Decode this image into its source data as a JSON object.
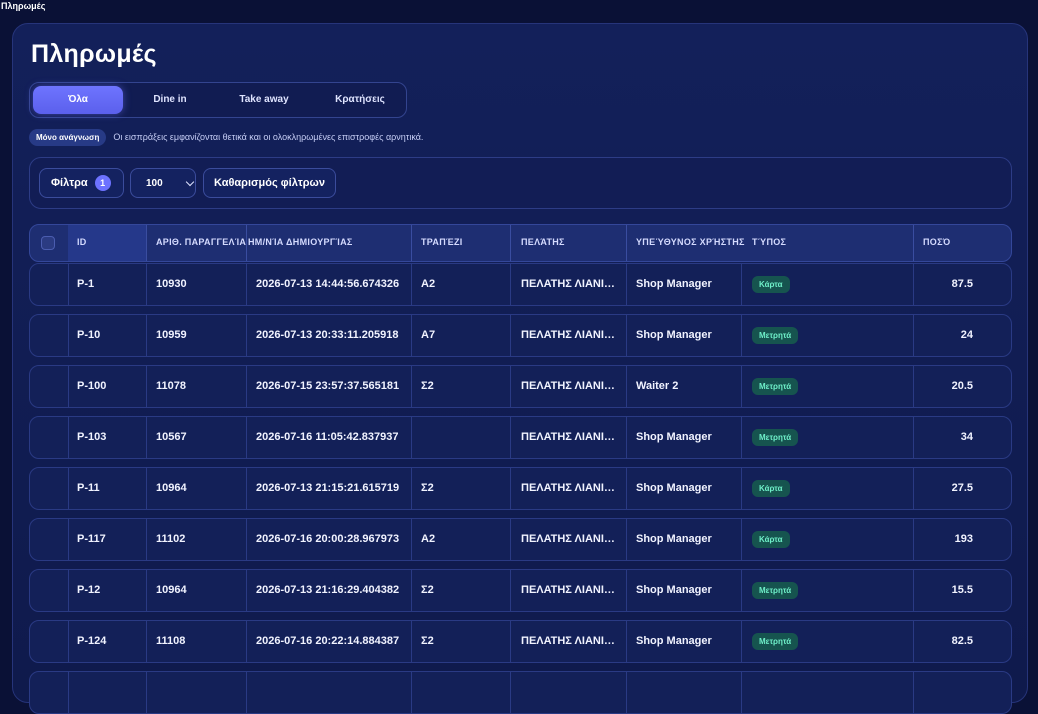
{
  "window": {
    "title": "Πληρωμές"
  },
  "page": {
    "title": "Πληρωμές"
  },
  "tabs": [
    {
      "label": "Όλα",
      "active": true
    },
    {
      "label": "Dine in",
      "active": false
    },
    {
      "label": "Take away",
      "active": false
    },
    {
      "label": "Κρατήσεις",
      "active": false
    }
  ],
  "readonly": {
    "badge": "Μόνο ανάγνωση",
    "note": "Οι εισπράξεις εμφανίζονται θετικά και οι ολοκληρωμένες επιστροφές αρνητικά."
  },
  "filters": {
    "filters_label": "Φίλτρα",
    "filters_count": "1",
    "page_size": "100",
    "clear_label": "Καθαρισμός φίλτρων"
  },
  "colors": {
    "accent": "#6d72ff",
    "background": "#0a1136",
    "payment_pill_bg": "#16544f",
    "payment_pill_text": "#6ff0c9"
  },
  "table": {
    "columns": {
      "id": "ID",
      "order_no": "ΑΡΙΘ. ΠΑΡΑΓΓΕΛΊΑΣ",
      "created": "ΗΜ/ΝΊΑ ΔΗΜΙΟΥΡΓΊΑΣ",
      "table": "ΤΡΑΠΈΖΙ",
      "customer": "ΠΕΛΆΤΗΣ",
      "user": "ΥΠΕΎΘΥΝΟΣ ΧΡΉΣΤΗΣ",
      "type": "ΤΎΠΟΣ",
      "amount": "ΠΟΣΌ"
    },
    "rows": [
      {
        "id": "P-1",
        "order_no": "10930",
        "created": "2026-07-13 14:44:56.674326",
        "table": "A2",
        "customer": "ΠΕΛΑΤΗΣ ΛΙΑΝΙΚΗΣ",
        "user": "Shop Manager",
        "type": "Κάρτα",
        "amount": "87.5"
      },
      {
        "id": "P-10",
        "order_no": "10959",
        "created": "2026-07-13 20:33:11.205918",
        "table": "A7",
        "customer": "ΠΕΛΑΤΗΣ ΛΙΑΝΙΚΗΣ",
        "user": "Shop Manager",
        "type": "Μετρητά",
        "amount": "24"
      },
      {
        "id": "P-100",
        "order_no": "11078",
        "created": "2026-07-15 23:57:37.565181",
        "table": "Σ2",
        "customer": "ΠΕΛΑΤΗΣ ΛΙΑΝΙΚΗΣ",
        "user": "Waiter 2",
        "type": "Μετρητά",
        "amount": "20.5"
      },
      {
        "id": "P-103",
        "order_no": "10567",
        "created": "2026-07-16 11:05:42.837937",
        "table": "",
        "customer": "ΠΕΛΑΤΗΣ ΛΙΑΝΙΚΗΣ",
        "user": "Shop Manager",
        "type": "Μετρητά",
        "amount": "34"
      },
      {
        "id": "P-11",
        "order_no": "10964",
        "created": "2026-07-13 21:15:21.615719",
        "table": "Σ2",
        "customer": "ΠΕΛΑΤΗΣ ΛΙΑΝΙΚΗΣ",
        "user": "Shop Manager",
        "type": "Κάρτα",
        "amount": "27.5"
      },
      {
        "id": "P-117",
        "order_no": "11102",
        "created": "2026-07-16 20:00:28.967973",
        "table": "A2",
        "customer": "ΠΕΛΑΤΗΣ ΛΙΑΝΙΚΗΣ",
        "user": "Shop Manager",
        "type": "Κάρτα",
        "amount": "193"
      },
      {
        "id": "P-12",
        "order_no": "10964",
        "created": "2026-07-13 21:16:29.404382",
        "table": "Σ2",
        "customer": "ΠΕΛΑΤΗΣ ΛΙΑΝΙΚΗΣ",
        "user": "Shop Manager",
        "type": "Μετρητά",
        "amount": "15.5"
      },
      {
        "id": "P-124",
        "order_no": "11108",
        "created": "2026-07-16 20:22:14.884387",
        "table": "Σ2",
        "customer": "ΠΕΛΑΤΗΣ ΛΙΑΝΙΚΗΣ",
        "user": "Shop Manager",
        "type": "Μετρητά",
        "amount": "82.5"
      },
      {
        "id": "",
        "order_no": "",
        "created": "",
        "table": "",
        "customer": "",
        "user": "",
        "type": "",
        "amount": ""
      }
    ]
  }
}
